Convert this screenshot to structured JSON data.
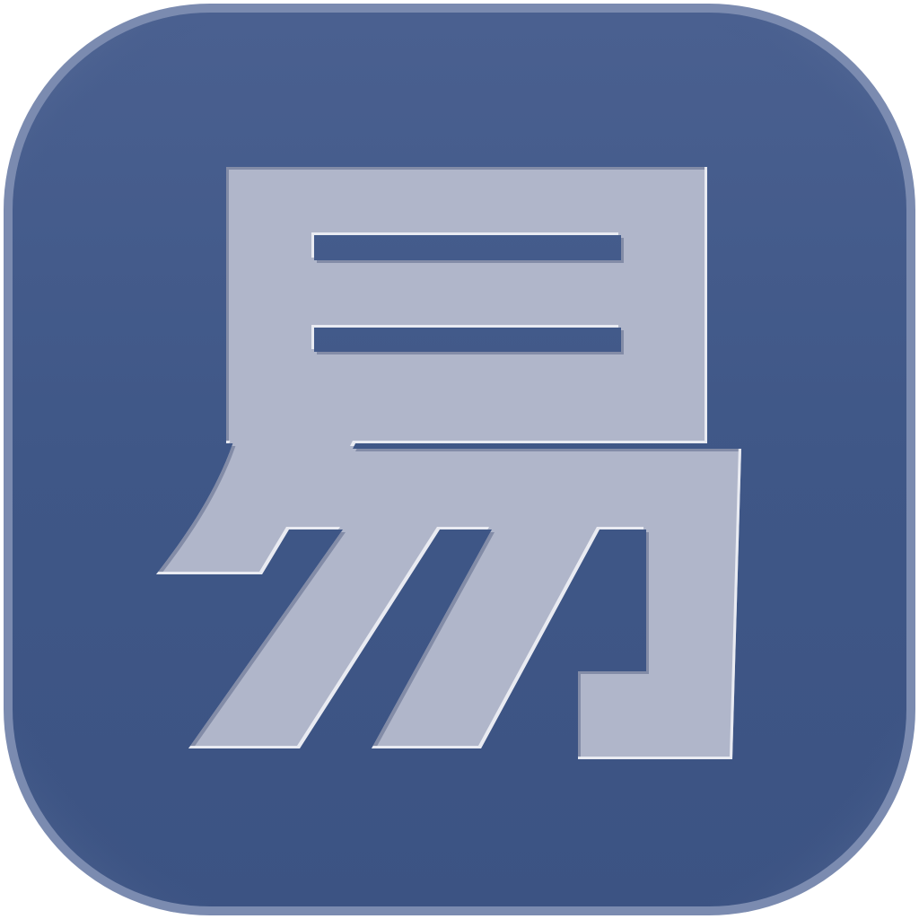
{
  "icon": {
    "name": "app-icon-yi",
    "glyph": "易",
    "colors": {
      "background": "#3f5787",
      "background_edge": "#7d8db0",
      "glyph_fill": "#b0b6ca",
      "glyph_highlight": "#e3e6ef",
      "glyph_shadow": "#2b3e66"
    }
  }
}
